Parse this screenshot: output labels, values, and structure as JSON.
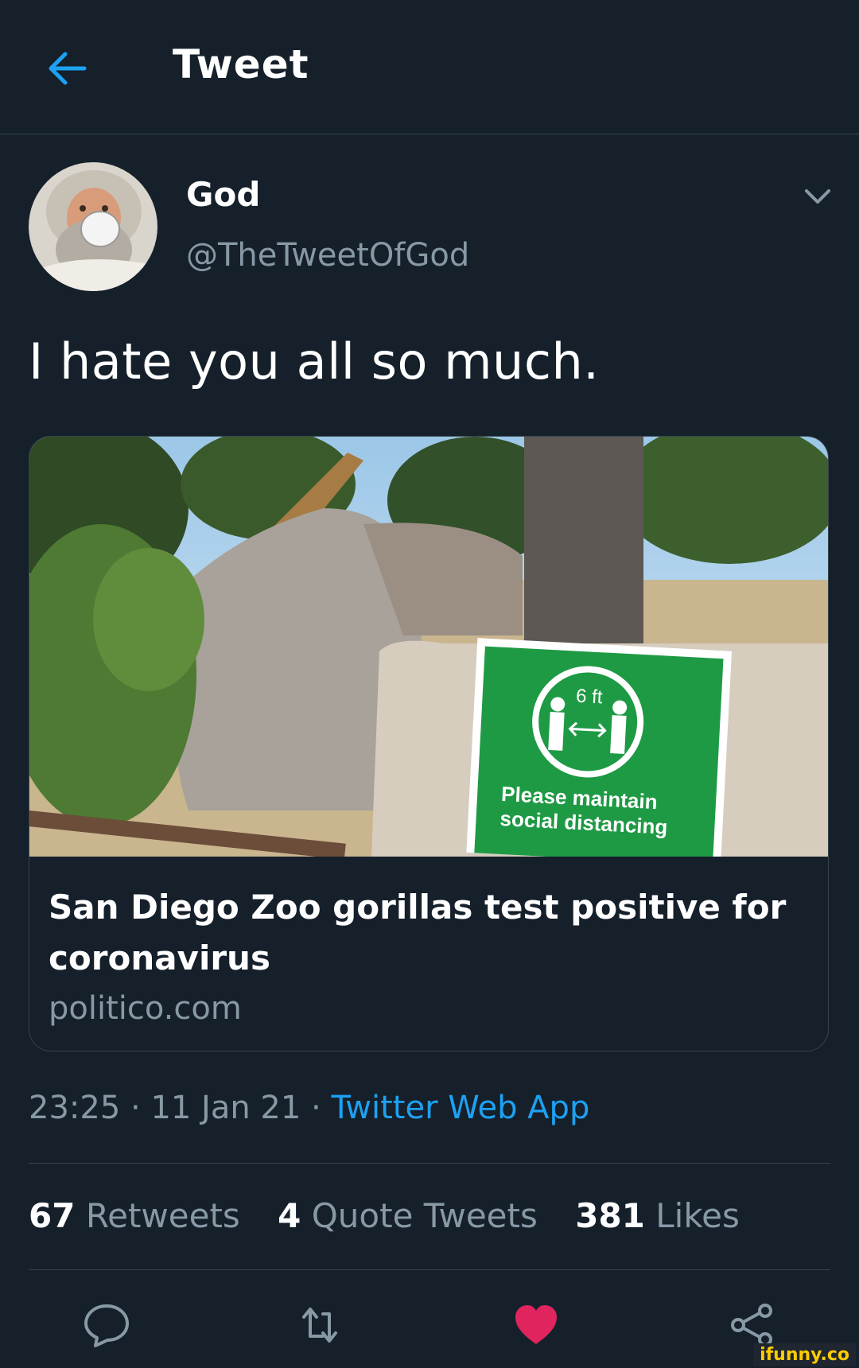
{
  "header": {
    "title": "Tweet",
    "back_icon": "arrow-left-icon"
  },
  "author": {
    "display_name": "God",
    "handle": "@TheTweetOfGod",
    "avatar_icon": "avatar-image",
    "menu_icon": "chevron-down-icon"
  },
  "tweet": {
    "text": "I hate you all so much."
  },
  "card": {
    "title": "San Diego Zoo gorillas test positive for coronavirus",
    "domain": "politico.com",
    "sign": {
      "distance": "6 ft",
      "line1": "Please maintain",
      "line2": "social distancing"
    }
  },
  "meta": {
    "time": "23:25",
    "date": "11 Jan 21",
    "separator": " · ",
    "source": "Twitter Web App"
  },
  "stats": {
    "retweets_count": "67",
    "retweets_label": "Retweets",
    "quotes_count": "4",
    "quotes_label": "Quote Tweets",
    "likes_count": "381",
    "likes_label": "Likes"
  },
  "actions": {
    "reply_icon": "reply-icon",
    "retweet_icon": "retweet-icon",
    "like_icon": "heart-icon",
    "share_icon": "share-icon"
  },
  "colors": {
    "background": "#15202b",
    "accent": "#1da1f2",
    "muted": "#8899a6",
    "like": "#e0245e",
    "divider": "#38444d"
  },
  "watermark": "ifunny.co"
}
